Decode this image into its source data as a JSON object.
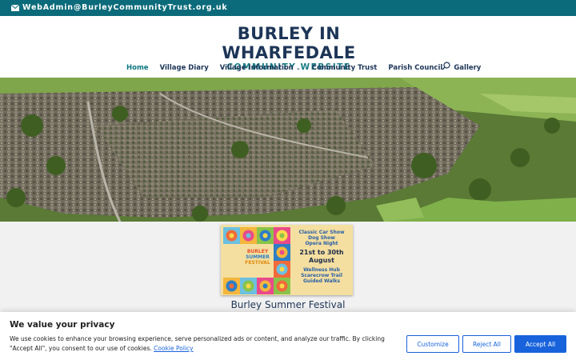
{
  "topbar": {
    "email": "WebAdmin@BurleyCommunityTrust.org.uk",
    "icon": "envelope-icon"
  },
  "logo": {
    "title": "BURLEY IN WHARFEDALE",
    "subtitle": "COMMUNITY WEBSITE"
  },
  "nav": {
    "items": [
      {
        "label": "Home",
        "active": true
      },
      {
        "label": "Village Diary"
      },
      {
        "label": "Village Information",
        "has_dropdown": true
      },
      {
        "label": "Community Trust"
      },
      {
        "label": "Parish Council"
      },
      {
        "label": "Gallery"
      }
    ],
    "search_icon": "search-icon"
  },
  "poster": {
    "title_lines": [
      "BURLEY",
      "SUMMER",
      "FESTIVAL"
    ],
    "lines_top": [
      "Classic Car Show",
      "Dog Show",
      "Opera Night"
    ],
    "dates": "21st to 30th August",
    "lines_bottom": [
      "Wellness Hub",
      "Scarecrow Trail",
      "Guided Walks"
    ]
  },
  "festival": {
    "caption": "Burley Summer Festival"
  },
  "cookie": {
    "title": "We value your privacy",
    "text": "We use cookies to enhance your browsing experience, serve personalized ads or content, and analyze our traffic. By clicking \"Accept All\", you consent to our use of cookies.",
    "link_label": "Cookie Policy",
    "customize_label": "Customize",
    "reject_label": "Reject All",
    "accept_label": "Accept All"
  },
  "colors": {
    "topbar": "#0c6b7a",
    "brand_navy": "#1d3557",
    "brand_teal": "#1a7c86",
    "cookie_blue": "#1863dc"
  }
}
